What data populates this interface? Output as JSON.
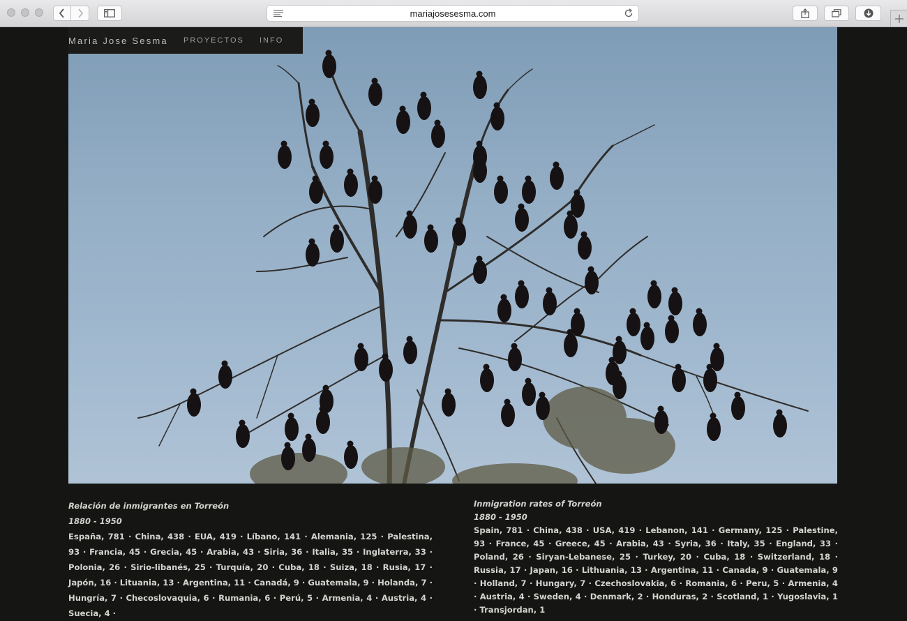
{
  "browser": {
    "url": "mariajosesesma.com"
  },
  "site": {
    "name": "Maria Jose Sesma",
    "nav": [
      "PROYECTOS",
      "INFO"
    ]
  },
  "es": {
    "title": "Relación de inmigrantes en Torreón",
    "years": "1880 - 1950",
    "body": "España, 781 · China, 438 · EUA, 419 · Líbano, 141 · Alemania, 125 · Palestina, 93 · Francia, 45 · Grecia, 45 · Arabia, 43 · Siria, 36 · Italia, 35 · Inglaterra, 33 · Polonia, 26 · Sirio-libanés, 25 · Turquía, 20 · Cuba, 18 · Suiza, 18 · Rusia, 17 · Japón, 16 · Lituania, 13 · Argentina, 11 · Canadá, 9 · Guatemala, 9 · Holanda, 7 · Hungría, 7 · Checoslovaquia, 6 · Rumania, 6 · Perú, 5 · Armenia, 4 · Austria, 4 · Suecia, 4 ·"
  },
  "en": {
    "title": "Inmigration rates of Torreón",
    "years": "1880 - 1950",
    "body": "Spain, 781 · China, 438 · USA, 419 · Lebanon, 141 · Germany, 125 · Palestine, 93 · France, 45 · Greece, 45 · Arabia, 43 · Syria, 36 · Italy, 35 · England, 33 · Poland, 26 · Siryan-Lebanese, 25 · Turkey, 20 · Cuba, 18 · Switzerland, 18 · Russia, 17 · Japan, 16 · Lithuania, 13 · Argentina, 11 · Canada, 9 · Guatemala, 9 · Holland, 7 · Hungary, 7 · Czechoslovakia, 6 · Romania, 6 · Peru, 5 · Armenia, 4 · Austria, 4 · Sweden, 4 · Denmark, 2 · Honduras, 2 · Scotland, 1 · Yugoslavia, 1 · Transjordan, 1"
  },
  "icons": {
    "back": "chevron-left-icon",
    "forward": "chevron-right-icon",
    "sidebar": "sidebar-icon",
    "reader": "reader-icon",
    "reload": "reload-icon",
    "share": "share-icon",
    "tabs": "tabs-overview-icon",
    "downloads": "downloads-icon",
    "new_tab": "plus-icon"
  }
}
